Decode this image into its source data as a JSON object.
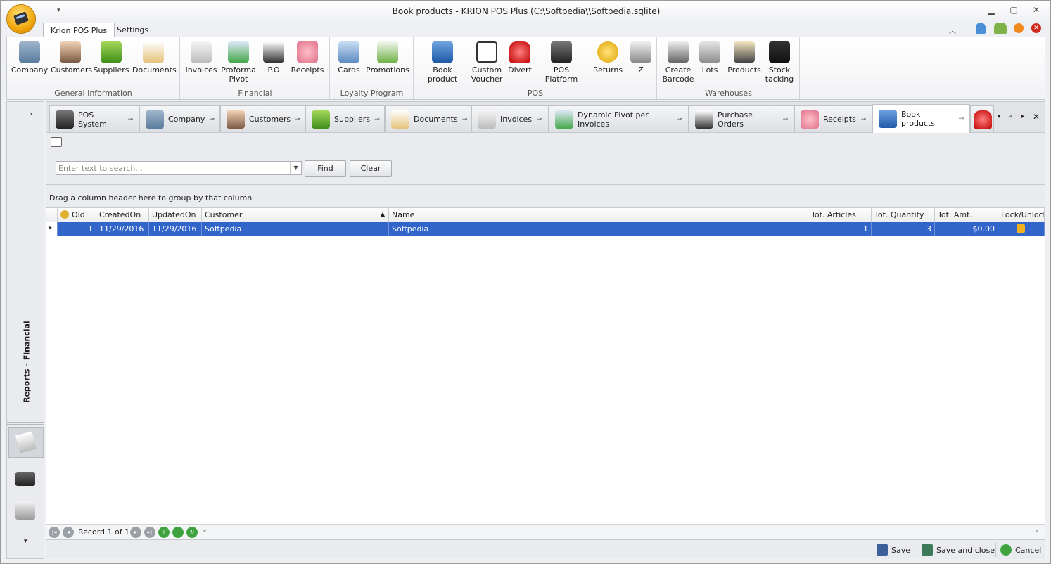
{
  "window": {
    "title": "Book products - KRION POS Plus (C:\\Softpedia\\\\Softpedia.sqlite)",
    "qat_icon": "chevron-down-icon"
  },
  "ribbon_tabs": [
    "Krion POS Plus",
    "Settings"
  ],
  "ribbon": {
    "groups": [
      {
        "label": "General Information",
        "buttons": [
          "Company",
          "Customers",
          "Suppliers",
          "Documents"
        ]
      },
      {
        "label": "Financial",
        "buttons": [
          "Invoices",
          "Proforma\nPivot",
          "P.O",
          "Receipts"
        ]
      },
      {
        "label": "Loyalty Program",
        "buttons": [
          "Cards",
          "Promotions"
        ]
      },
      {
        "label": "POS",
        "buttons": [
          "Book product",
          "Custom\nVoucher",
          "Divert",
          "POS Platform",
          "Returns",
          "Z"
        ]
      },
      {
        "label": "Warehouses",
        "buttons": [
          "Create\nBarcode",
          "Lots",
          "Products",
          "Stock\ntacking"
        ]
      }
    ]
  },
  "sidebar": {
    "label": "Reports - Financial"
  },
  "doc_tabs": [
    "POS System",
    "Company",
    "Customers",
    "Suppliers",
    "Documents",
    "Invoices",
    "Dynamic Pivot per Invoices",
    "Purchase Orders",
    "Receipts",
    "Book products"
  ],
  "search": {
    "placeholder": "Enter text to search...",
    "find": "Find",
    "clear": "Clear"
  },
  "group_hint": "Drag a column header here to group by that column",
  "grid": {
    "columns": [
      "Oid",
      "CreatedOn",
      "UpdatedOn",
      "Customer",
      "Name",
      "Tot. Articles",
      "Tot. Quantity",
      "Tot. Amt.",
      "Lock/Unlock"
    ],
    "rows": [
      [
        "1",
        "11/29/2016",
        "11/29/2016",
        "Softpedia",
        "Softpedia",
        "1",
        "3",
        "$0.00",
        ""
      ]
    ]
  },
  "navigator": {
    "text": "Record 1 of 1"
  },
  "footer": {
    "save": "Save",
    "save_close": "Save and close",
    "cancel": "Cancel"
  },
  "colors": {
    "selection": "#3165c9",
    "accent": "#f0a60c"
  }
}
